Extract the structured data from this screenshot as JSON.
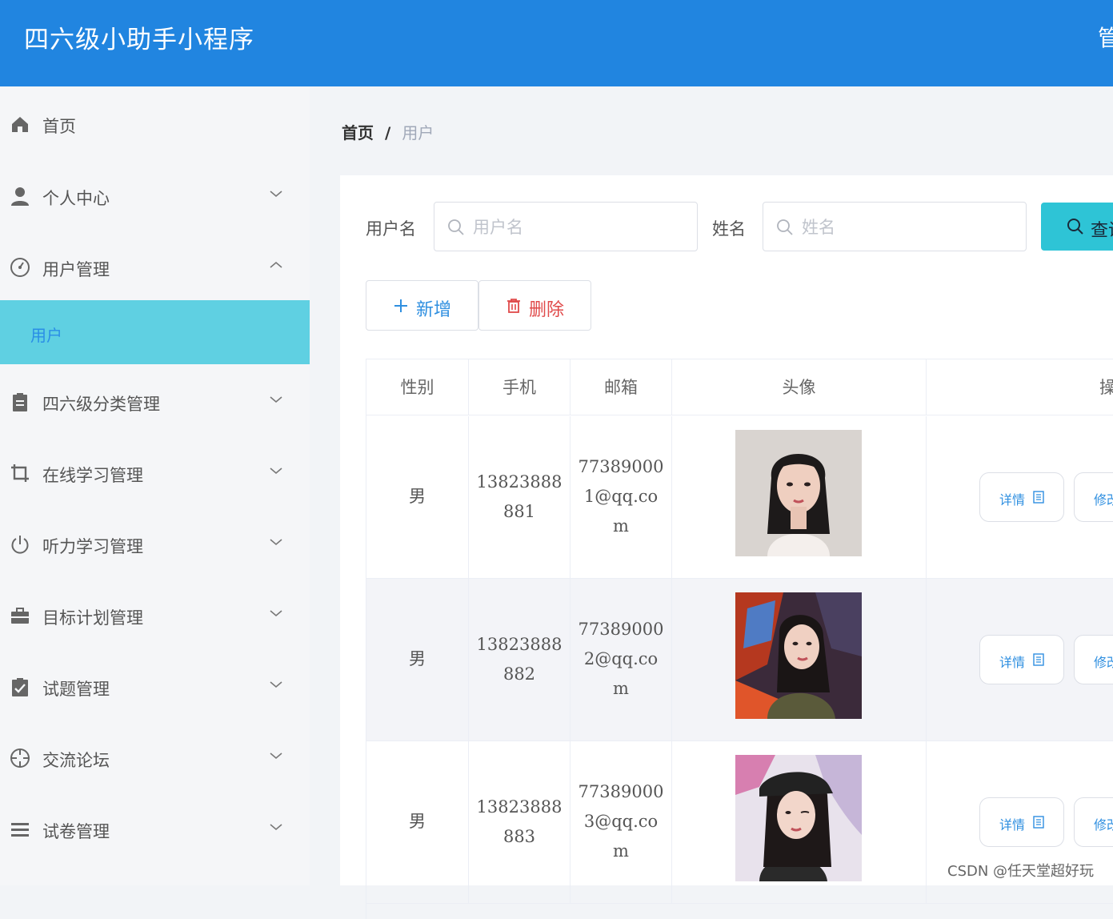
{
  "header": {
    "app_title": "四六级小助手小程序",
    "right_text": "管"
  },
  "sidebar": {
    "items": [
      {
        "label": "首页",
        "icon": "home-icon"
      },
      {
        "label": "个人中心",
        "icon": "user-icon"
      },
      {
        "label": "用户管理",
        "icon": "dashboard-icon"
      },
      {
        "label": "四六级分类管理",
        "icon": "clipboard-icon"
      },
      {
        "label": "在线学习管理",
        "icon": "crop-icon"
      },
      {
        "label": "听力学习管理",
        "icon": "power-icon"
      },
      {
        "label": "目标计划管理",
        "icon": "briefcase-icon"
      },
      {
        "label": "试题管理",
        "icon": "checklist-icon"
      },
      {
        "label": "交流论坛",
        "icon": "crosshair-icon"
      },
      {
        "label": "试卷管理",
        "icon": "list-icon"
      }
    ],
    "active_sub": "用户"
  },
  "breadcrumb": {
    "home": "首页",
    "sep": "/",
    "current": "用户"
  },
  "search": {
    "username_label": "用户名",
    "username_placeholder": "用户名",
    "name_label": "姓名",
    "name_placeholder": "姓名",
    "query_button": "查询"
  },
  "actions": {
    "add": "新增",
    "delete": "删除"
  },
  "table": {
    "columns": [
      "性别",
      "手机",
      "邮箱",
      "头像",
      "操作"
    ],
    "rows": [
      {
        "gender": "男",
        "phone_1": "13823888",
        "phone_2": "881",
        "email_1": "77389000",
        "email_2": "1@qq.co",
        "email_3": "m",
        "avatar": "avatar-photo-1"
      },
      {
        "gender": "男",
        "phone_1": "13823888",
        "phone_2": "882",
        "email_1": "77389000",
        "email_2": "2@qq.co",
        "email_3": "m",
        "avatar": "avatar-photo-2"
      },
      {
        "gender": "男",
        "phone_1": "13823888",
        "phone_2": "883",
        "email_1": "77389000",
        "email_2": "3@qq.co",
        "email_3": "m",
        "avatar": "avatar-photo-3"
      }
    ],
    "detail_button": "详情",
    "edit_button": "修改"
  },
  "watermark": "CSDN @任天堂超好玩",
  "colors": {
    "header": "#2185e0",
    "active_menu": "#5fd0e2",
    "query_button": "#2ec4d6",
    "delete": "#e04a4a",
    "add": "#2f8fe0"
  }
}
